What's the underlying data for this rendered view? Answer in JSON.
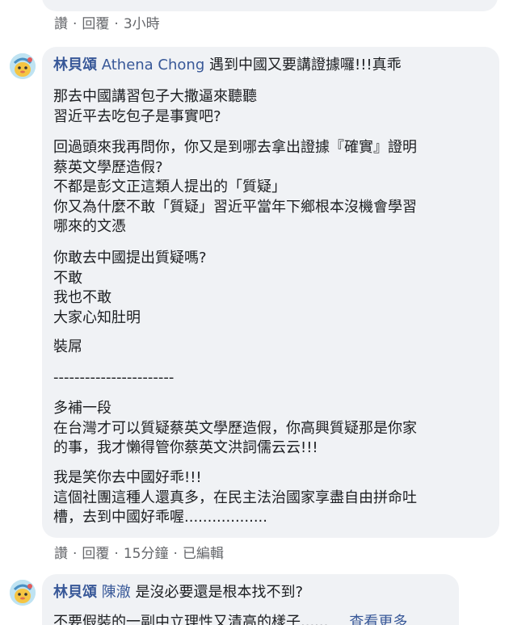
{
  "top_actions": {
    "like": "讚",
    "reply": "回覆",
    "time": "3小時"
  },
  "comment1": {
    "author": "林貝頌",
    "mention": "Athena Chong",
    "first_line": "遇到中國又要講證據囉!!!真乖",
    "paragraphs": [
      [
        "那去中國講習包子大撒逼來聽聽",
        "習近平去吃包子是事實吧?"
      ],
      [
        "回過頭來我再問你，你又是到哪去拿出證據『確實』證明",
        "蔡英文學歷造假?",
        "不都是彭文正這類人提出的「質疑」",
        "你又為什麼不敢「質疑」習近平當年下鄉根本沒機會學習",
        "哪來的文憑"
      ],
      [
        "你敢去中國提出質疑嗎?",
        "不敢",
        "我也不敢",
        "大家心知肚明"
      ],
      [
        "裝屌"
      ],
      [
        "-----------------------"
      ],
      [
        "多補一段",
        "在台灣才可以質疑蔡英文學歷造假，你高興質疑那是你家",
        "的事，我才懶得管你蔡英文洪詞儒云云!!!"
      ],
      [
        "我是笑你去中國好乖!!!",
        "這個社團這種人還真多，在民主法治國家享盡自由拼命吐",
        "槽，去到中國好乖喔.................."
      ]
    ],
    "actions": {
      "like": "讚",
      "reply": "回覆",
      "time": "15分鐘",
      "edited": "已編輯"
    }
  },
  "comment2": {
    "author": "林貝頌",
    "mention": "陳澈",
    "first_line": "是沒必要還是根本找不到?",
    "second_line": "不要假裝的一副中立理性又清高的樣子......",
    "see_more": "查看更多"
  },
  "colors": {
    "name_blue": "#385898",
    "bubble_bg": "#f0f2f5",
    "meta_gray": "#65676b",
    "text": "#1c1e21"
  }
}
